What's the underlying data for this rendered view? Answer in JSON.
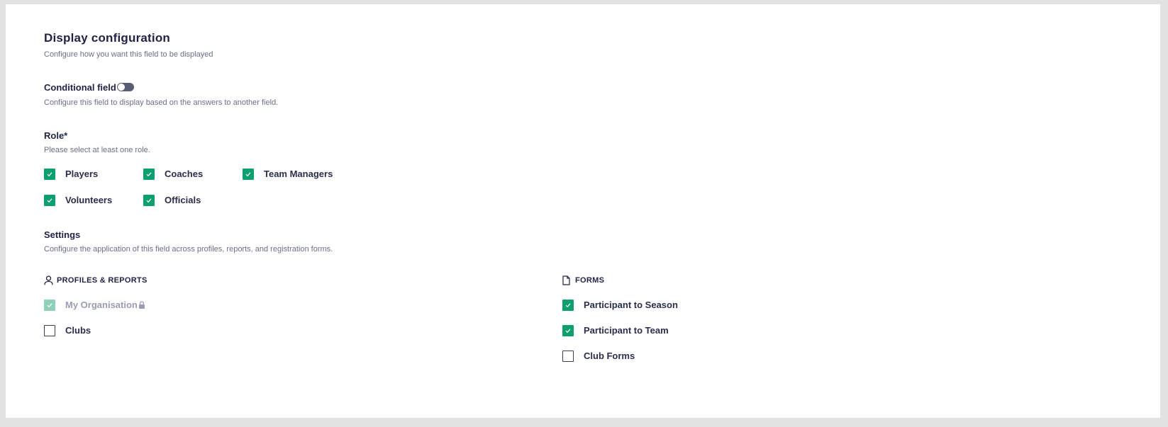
{
  "colors": {
    "accent": "#0e9f6e",
    "accent_disabled": "#8fd1b8",
    "text_primary": "#1f2245",
    "text_secondary": "#6b6f85",
    "page_background": "#e2e2e2"
  },
  "header": {
    "title": "Display configuration",
    "subtitle": "Configure how you want this field to be displayed"
  },
  "conditional": {
    "label": "Conditional field",
    "enabled": false,
    "description": "Configure this field to display based on the answers to another field."
  },
  "role": {
    "label": "Role*",
    "hint": "Please select at least one role.",
    "options": [
      {
        "label": "Players",
        "checked": true
      },
      {
        "label": "Coaches",
        "checked": true
      },
      {
        "label": "Team Managers",
        "checked": true
      },
      {
        "label": "Volunteers",
        "checked": true
      },
      {
        "label": "Officials",
        "checked": true
      }
    ]
  },
  "settings": {
    "label": "Settings",
    "description": "Configure the application of this field across profiles, reports, and registration forms.",
    "profiles": {
      "heading": "PROFILES & REPORTS",
      "icon": "user-icon",
      "options": [
        {
          "label": "My Organisation",
          "checked": true,
          "disabled": true,
          "locked": true
        },
        {
          "label": "Clubs",
          "checked": false
        }
      ]
    },
    "forms": {
      "heading": "FORMS",
      "icon": "document-icon",
      "options": [
        {
          "label": "Participant to Season",
          "checked": true
        },
        {
          "label": "Participant to Team",
          "checked": true
        },
        {
          "label": "Club Forms",
          "checked": false
        }
      ]
    }
  }
}
